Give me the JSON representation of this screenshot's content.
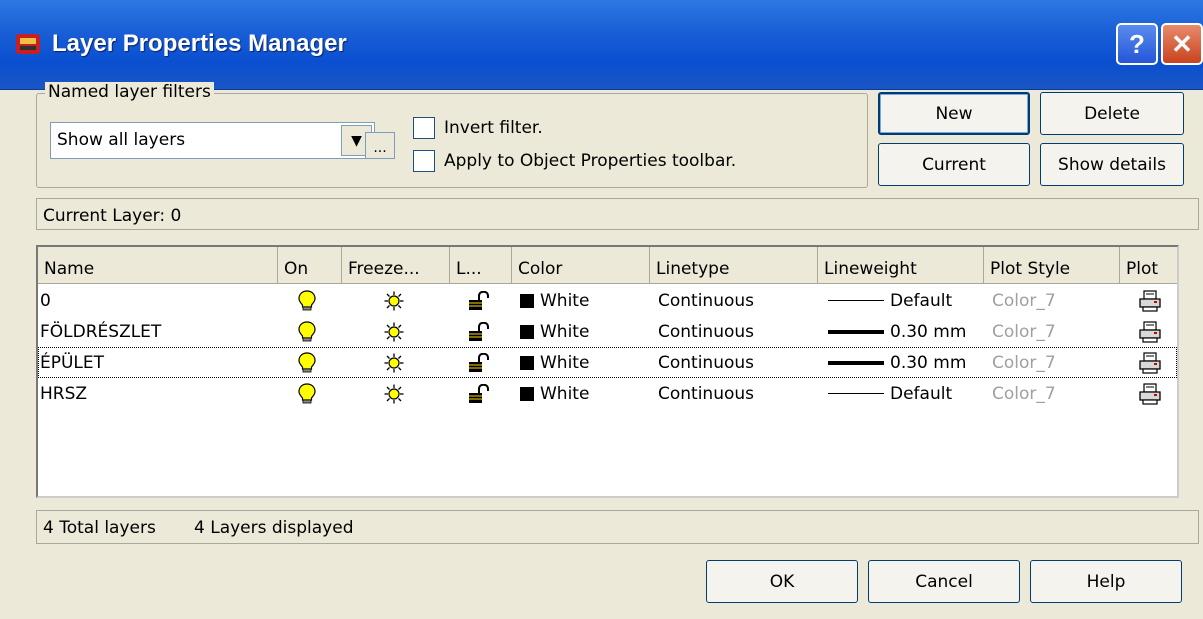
{
  "window": {
    "title": "Layer Properties Manager",
    "help_glyph": "?",
    "close_glyph": "✕"
  },
  "filters": {
    "group_label": "Named layer filters",
    "selected": "Show all layers",
    "dropdown_glyph": "▼",
    "browse_label": "...",
    "invert_label": "Invert filter.",
    "apply_label": "Apply to Object Properties toolbar."
  },
  "buttons": {
    "new": "New",
    "delete": "Delete",
    "current": "Current",
    "show_details": "Show details",
    "ok": "OK",
    "cancel": "Cancel",
    "help": "Help"
  },
  "current_layer": "Current Layer:  0",
  "columns": [
    "Name",
    "On",
    "Freeze...",
    "L...",
    "Color",
    "Linetype",
    "Lineweight",
    "Plot Style",
    "Plot"
  ],
  "layers": [
    {
      "name": "0",
      "color": "White",
      "linetype": "Continuous",
      "lineweight": "Default",
      "plot_style": "Color_7",
      "on": true,
      "frozen": false,
      "locked": false,
      "plot": true
    },
    {
      "name": "FÖLDRÉSZLET",
      "color": "White",
      "linetype": "Continuous",
      "lineweight": "0.30 mm",
      "plot_style": "Color_7",
      "on": true,
      "frozen": false,
      "locked": false,
      "plot": true
    },
    {
      "name": "ÉPÜLET",
      "color": "White",
      "linetype": "Continuous",
      "lineweight": "0.30 mm",
      "plot_style": "Color_7",
      "on": true,
      "frozen": false,
      "locked": false,
      "plot": true
    },
    {
      "name": "HRSZ",
      "color": "White",
      "linetype": "Continuous",
      "lineweight": "Default",
      "plot_style": "Color_7",
      "on": true,
      "frozen": false,
      "locked": false,
      "plot": true
    }
  ],
  "status": {
    "total": "4 Total layers",
    "displayed": "4 Layers displayed"
  },
  "colors": {
    "titlebar": "#0a4fd0",
    "dialog_bg": "#ece9d8",
    "bulb": "#ffff00",
    "sun": "#ffff00",
    "plot_style_text": "#a0a0a0"
  },
  "icons": {
    "on": "lightbulb-icon",
    "freeze": "sun-icon",
    "lock": "unlocked-padlock-icon",
    "plot": "printer-icon"
  }
}
